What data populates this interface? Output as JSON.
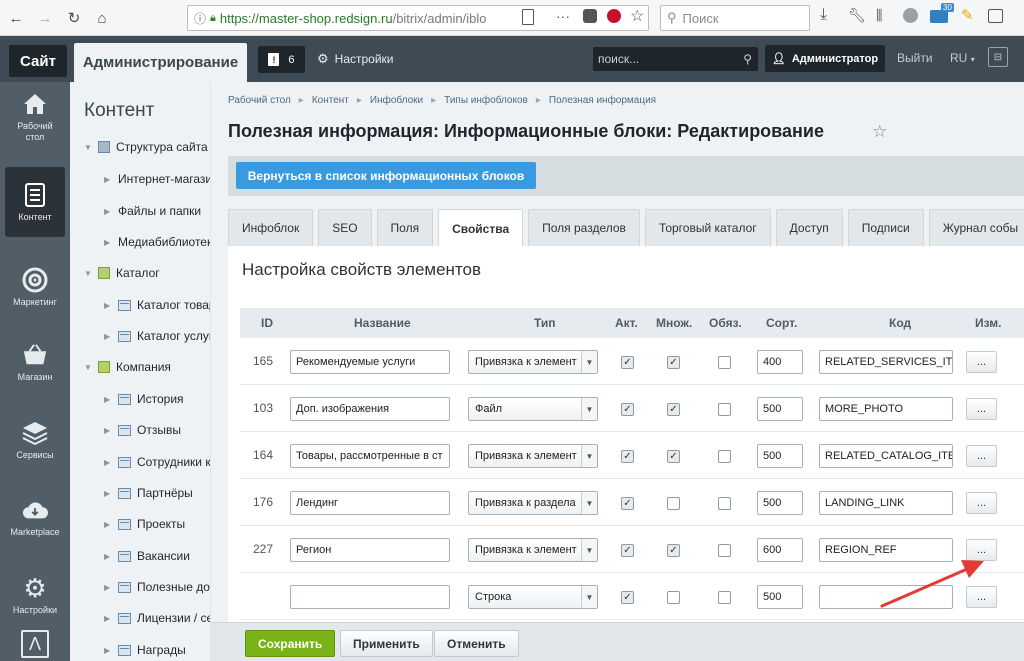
{
  "browser": {
    "url_host": "https://master-shop.redsign.ru",
    "url_path": "/bitrix/admin/iblo",
    "search_placeholder": "Поиск",
    "badge": "30"
  },
  "topbar": {
    "site_label": "Сайт",
    "admin_label": "Администрирование",
    "notif_count": "6",
    "settings_label": "Настройки",
    "search_placeholder": "поиск...",
    "user_label": "Администратор",
    "logout_label": "Выйти",
    "lang_label": "RU"
  },
  "iconbar": {
    "items": [
      {
        "label": "Рабочий стол",
        "icon": "home-icon"
      },
      {
        "label": "Контент",
        "icon": "document-icon"
      },
      {
        "label": "Маркетинг",
        "icon": "target-icon"
      },
      {
        "label": "Магазин",
        "icon": "basket-icon"
      },
      {
        "label": "Сервисы",
        "icon": "layers-icon"
      },
      {
        "label": "Marketplace",
        "icon": "cloud-download-icon"
      },
      {
        "label": "Настройки",
        "icon": "gear-icon"
      }
    ]
  },
  "tree": {
    "title": "Контент",
    "items": [
      {
        "label": "Структура сайта"
      },
      {
        "label": "Интернет-магазин"
      },
      {
        "label": "Файлы и папки"
      },
      {
        "label": "Медиабиблиотека"
      },
      {
        "label": "Каталог"
      },
      {
        "label": "Каталог товаров"
      },
      {
        "label": "Каталог услуг"
      },
      {
        "label": "Компания"
      },
      {
        "label": "История"
      },
      {
        "label": "Отзывы"
      },
      {
        "label": "Сотрудники к"
      },
      {
        "label": "Партнёры"
      },
      {
        "label": "Проекты"
      },
      {
        "label": "Вакансии"
      },
      {
        "label": "Полезные док"
      },
      {
        "label": "Лицензии / се"
      },
      {
        "label": "Награды"
      }
    ]
  },
  "breadcrumbs": [
    "Рабочий стол",
    "Контент",
    "Инфоблоки",
    "Типы инфоблоков",
    "Полезная информация"
  ],
  "page_title": "Полезная информация: Информационные блоки: Редактирование",
  "back_button": "Вернуться в список информационных блоков",
  "tabs": [
    {
      "label": "Инфоблок"
    },
    {
      "label": "SEO"
    },
    {
      "label": "Поля"
    },
    {
      "label": "Свойства"
    },
    {
      "label": "Поля разделов"
    },
    {
      "label": "Торговый каталог"
    },
    {
      "label": "Доступ"
    },
    {
      "label": "Подписи"
    },
    {
      "label": "Журнал собы"
    }
  ],
  "panel_title": "Настройка свойств элементов",
  "table": {
    "headers": {
      "id": "ID",
      "name": "Название",
      "type": "Тип",
      "active": "Акт.",
      "multiple": "Множ.",
      "required": "Обяз.",
      "sort": "Сорт.",
      "code": "Код",
      "edit": "Изм."
    },
    "rows": [
      {
        "id": "165",
        "name": "Рекомендуемые услуги",
        "type": "Привязка к элемент",
        "active": true,
        "multiple": true,
        "required": false,
        "sort": "400",
        "code": "RELATED_SERVICES_ITE",
        "edit": "..."
      },
      {
        "id": "103",
        "name": "Доп. изображения",
        "type": "Файл",
        "active": true,
        "multiple": true,
        "required": false,
        "sort": "500",
        "code": "MORE_PHOTO",
        "edit": "..."
      },
      {
        "id": "164",
        "name": "Товары, рассмотренные в ст",
        "type": "Привязка к элемент",
        "active": true,
        "multiple": true,
        "required": false,
        "sort": "500",
        "code": "RELATED_CATALOG_ITE",
        "edit": "..."
      },
      {
        "id": "176",
        "name": "Лендинг",
        "type": "Привязка к раздела",
        "active": true,
        "multiple": false,
        "required": false,
        "sort": "500",
        "code": "LANDING_LINK",
        "edit": "..."
      },
      {
        "id": "227",
        "name": "Регион",
        "type": "Привязка к элемент",
        "active": true,
        "multiple": true,
        "required": false,
        "sort": "600",
        "code": "REGION_REF",
        "edit": "..."
      },
      {
        "id": "",
        "name": "",
        "type": "Строка",
        "active": true,
        "multiple": false,
        "required": false,
        "sort": "500",
        "code": "",
        "edit": "..."
      }
    ]
  },
  "footer": {
    "save": "Сохранить",
    "apply": "Применить",
    "cancel": "Отменить"
  },
  "colors": {
    "accent": "#3a9ae0",
    "save": "#7ab317",
    "annotation_arrow": "#e53935"
  }
}
